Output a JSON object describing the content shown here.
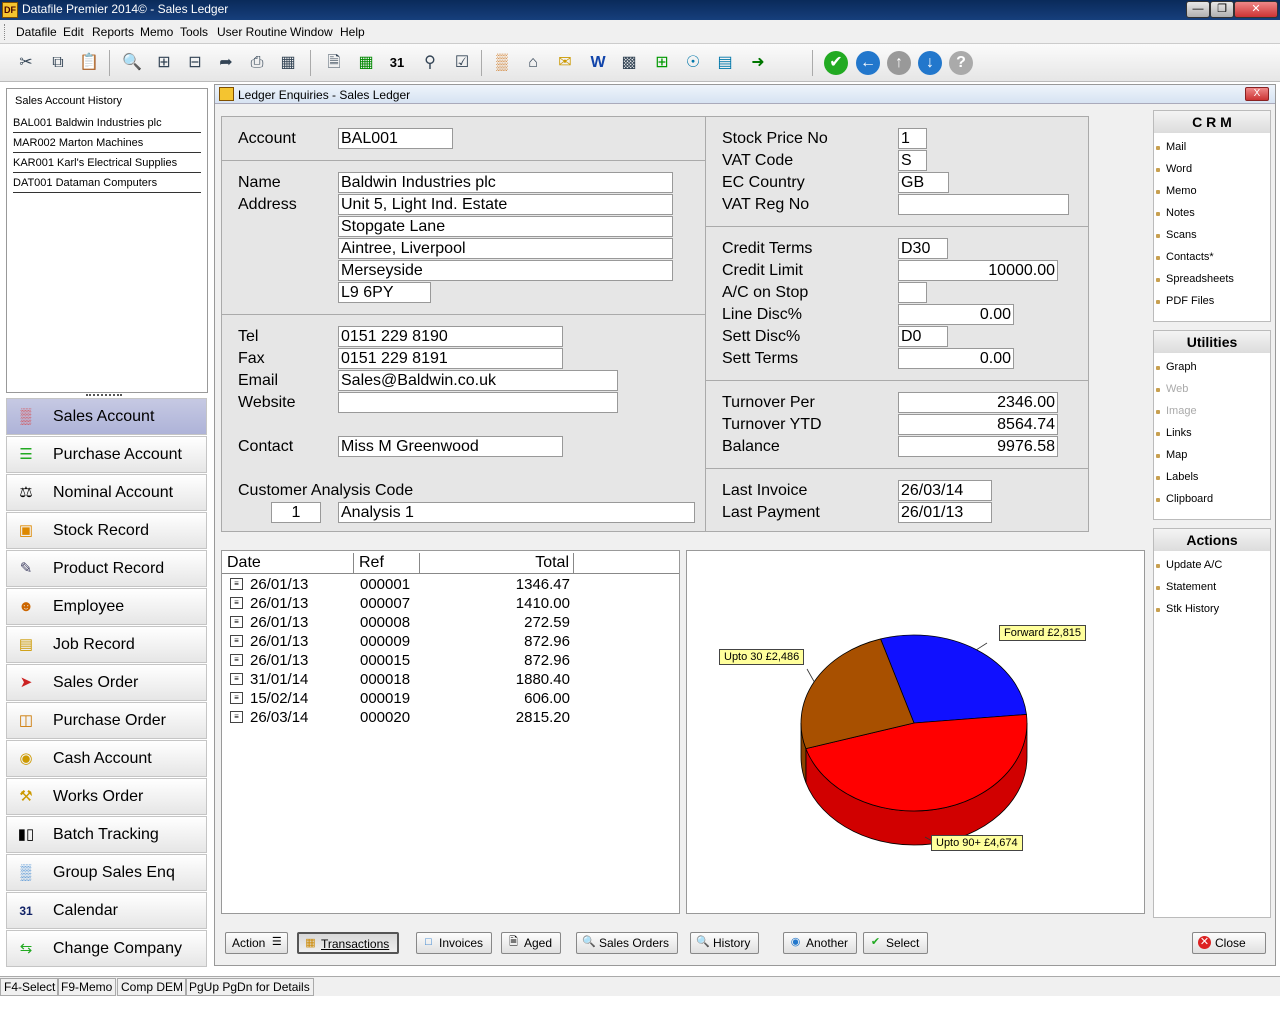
{
  "window": {
    "title": "Datafile  Premier 2014© - Sales Ledger",
    "logo_text": "DF"
  },
  "menu": [
    "Datafile",
    "Edit",
    "Reports",
    "Memo",
    "Tools",
    "User Routine",
    "Window",
    "Help"
  ],
  "history": {
    "title": "Sales Account  History",
    "items": [
      "BAL001 Baldwin Industries plc",
      "MAR002 Marton Machines",
      "KAR001 Karl's Electrical Supplies",
      "DAT001 Dataman Computers"
    ]
  },
  "nav": [
    "Sales Account",
    "Purchase Account",
    "Nominal Account",
    "Stock Record",
    "Product Record",
    "Employee",
    "Job Record",
    "Sales Order",
    "Purchase Order",
    "Cash Account",
    "Works Order",
    "Batch Tracking",
    "Group Sales Enq",
    "Calendar",
    "Change Company"
  ],
  "sub": {
    "title": "Ledger Enquiries - Sales Ledger",
    "close": "X"
  },
  "account": {
    "account_label": "Account",
    "account": "BAL001",
    "name_label": "Name",
    "address_label": "Address",
    "name": "Baldwin Industries plc",
    "address": [
      "Unit 5, Light Ind. Estate",
      "Stopgate Lane",
      "Aintree, Liverpool",
      "Merseyside",
      "L9 6PY"
    ],
    "tel_label": "Tel",
    "tel": "0151 229 8190",
    "fax_label": "Fax",
    "fax": "0151 229 8191",
    "email_label": "Email",
    "email": "Sales@Baldwin.co.uk",
    "website_label": "Website",
    "website": "",
    "contact_label": "Contact",
    "contact": "Miss M Greenwood",
    "analysis_label": "Customer Analysis Code",
    "analysis_code": "1",
    "analysis_name": "Analysis 1"
  },
  "details": {
    "stock_price_label": "Stock Price No",
    "stock_price": "1",
    "vat_code_label": "VAT Code",
    "vat_code": "S",
    "ec_country_label": "EC Country",
    "ec_country": "GB",
    "vat_reg_label": "VAT Reg No",
    "vat_reg": "",
    "credit_terms_label": "Credit Terms",
    "credit_terms": "D30",
    "credit_limit_label": "Credit Limit",
    "credit_limit": "10000.00",
    "on_stop_label": "A/C on Stop",
    "on_stop": "",
    "line_disc_label": "Line Disc%",
    "line_disc": "0.00",
    "sett_disc_label": "Sett Disc%",
    "sett_disc": "D0",
    "sett_terms_label": "Sett Terms",
    "sett_terms": "0.00",
    "turnover_per_label": "Turnover Per",
    "turnover_per": "2346.00",
    "turnover_ytd_label": "Turnover YTD",
    "turnover_ytd": "8564.74",
    "balance_label": "Balance",
    "balance": "9976.58",
    "last_invoice_label": "Last Invoice",
    "last_invoice": "26/03/14",
    "last_payment_label": "Last Payment",
    "last_payment": "26/01/13"
  },
  "transactions": {
    "headers": [
      "Date",
      "Ref",
      "Total"
    ],
    "rows": [
      {
        "date": "26/01/13",
        "ref": "000001",
        "total": "1346.47"
      },
      {
        "date": "26/01/13",
        "ref": "000007",
        "total": "1410.00"
      },
      {
        "date": "26/01/13",
        "ref": "000008",
        "total": "272.59"
      },
      {
        "date": "26/01/13",
        "ref": "000009",
        "total": "872.96"
      },
      {
        "date": "26/01/13",
        "ref": "000015",
        "total": "872.96"
      },
      {
        "date": "31/01/14",
        "ref": "000018",
        "total": "1880.40"
      },
      {
        "date": "15/02/14",
        "ref": "000019",
        "total": "606.00"
      },
      {
        "date": "26/03/14",
        "ref": "000020",
        "total": "2815.20"
      }
    ]
  },
  "chart_data": {
    "type": "pie",
    "slices": [
      {
        "label": "Forward £2,815",
        "value": 2815,
        "color": "#1010ff"
      },
      {
        "label": "Upto 90+ £4,674",
        "value": 4674,
        "color": "#ff0000"
      },
      {
        "label": "Upto 30 £2,486",
        "value": 2486,
        "color": "#a85000"
      }
    ]
  },
  "side": {
    "crm": {
      "title": "C R M",
      "items": [
        "Mail",
        "Word",
        "Memo",
        "Notes",
        "Scans",
        "Contacts*",
        "Spreadsheets",
        "PDF Files"
      ]
    },
    "utilities": {
      "title": "Utilities",
      "items": [
        "Graph",
        "Web",
        "Image",
        "Links",
        "Map",
        "Labels",
        "Clipboard"
      ]
    },
    "actions": {
      "title": "Actions",
      "items": [
        "Update A/C",
        "Statement",
        "Stk History"
      ]
    }
  },
  "buttons": {
    "action": "Action",
    "transactions": "Transactions",
    "invoices": "Invoices",
    "aged": "Aged",
    "sales_orders": "Sales Orders",
    "history": "History",
    "another": "Another",
    "select": "Select",
    "close": "Close"
  },
  "status": [
    "F4-Select",
    "F9-Memo",
    "Comp DEM",
    "PgUp PgDn for Details"
  ]
}
